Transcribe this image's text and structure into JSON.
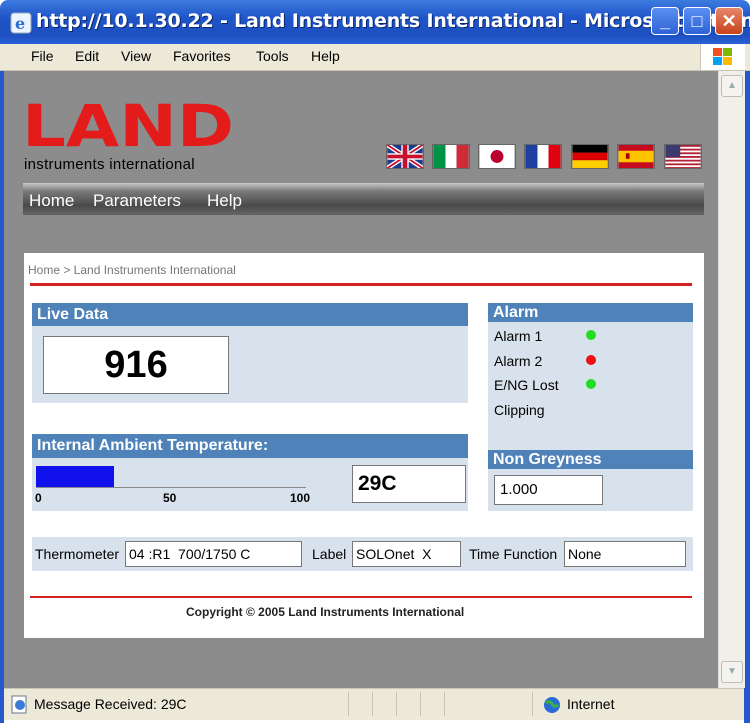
{
  "window": {
    "title": "http://10.1.30.22 - Land Instruments International - Microsoft Intern...",
    "minimize": "_",
    "maximize": "□",
    "close": "✕"
  },
  "menu": [
    "File",
    "Edit",
    "View",
    "Favorites",
    "Tools",
    "Help"
  ],
  "brand": {
    "logo": "LAND",
    "subtitle": "instruments international",
    "logo_color": "#e41b1b"
  },
  "flags": [
    "uk-flag",
    "italy-flag",
    "japan-flag",
    "france-flag",
    "germany-flag",
    "spain-flag",
    "usa-flag"
  ],
  "nav": [
    "Home",
    "Parameters",
    "Help"
  ],
  "breadcrumb": "Home > Land Instruments International",
  "live_data": {
    "title": "Live Data",
    "value": "916"
  },
  "alarm": {
    "title": "Alarm",
    "items": [
      {
        "label": "Alarm 1",
        "status": "green"
      },
      {
        "label": "Alarm 2",
        "status": "red"
      },
      {
        "label": "E/NG Lost",
        "status": "green"
      },
      {
        "label": "Clipping",
        "status": "none"
      }
    ]
  },
  "ambient": {
    "title": "Internal Ambient Temperature:",
    "fill_percent": 29,
    "scale": [
      "0",
      "50",
      "100"
    ],
    "value": "29C"
  },
  "non_greyness": {
    "title": "Non Greyness",
    "value": "1.000"
  },
  "info": {
    "thermometer_label": "Thermometer",
    "thermometer_value": "04 :R1  700/1750 C",
    "label_label": "Label",
    "label_value": "SOLOnet  X",
    "time_function_label": "Time Function",
    "time_function_value": "None"
  },
  "copyright": "Copyright © 2005 Land Instruments International",
  "status": {
    "message": "Message Received: 29C",
    "zone": "Internet"
  },
  "colors": {
    "panel_header": "#4e82b8",
    "panel_bg": "#d8e2ec",
    "bar_fill": "#1111ee",
    "red_rule": "#d42020",
    "alarm_green": "#22dd22",
    "alarm_red": "#ee1111"
  }
}
